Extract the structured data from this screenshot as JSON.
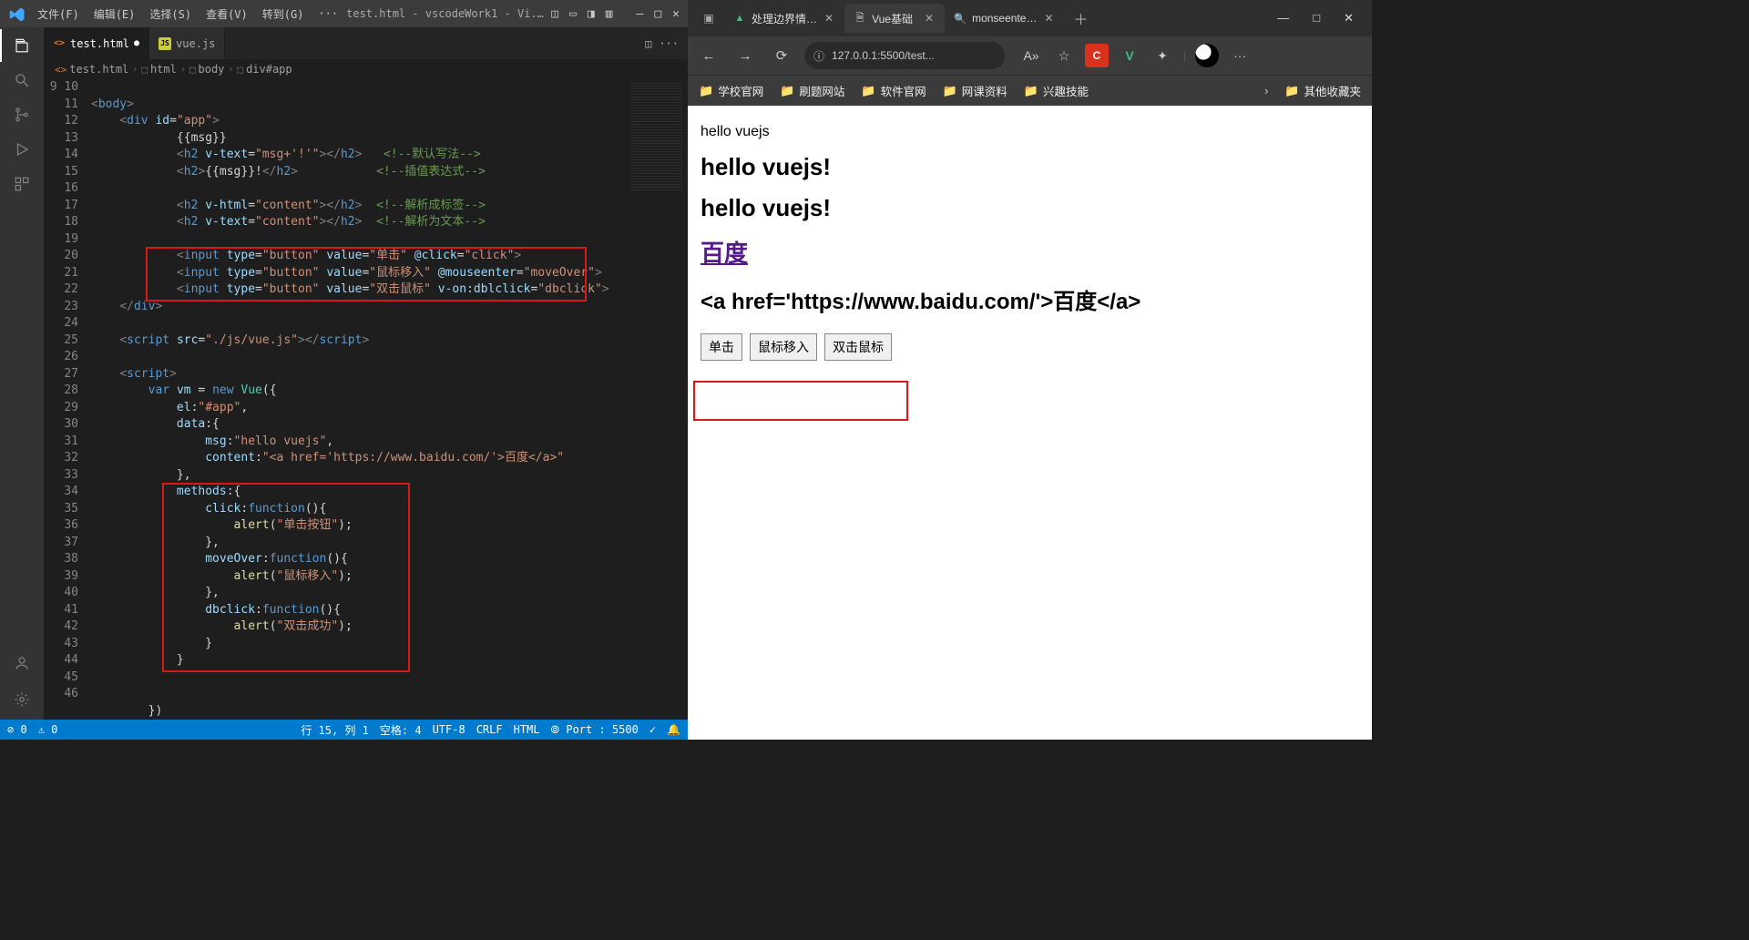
{
  "vscode": {
    "menu": [
      "文件(F)",
      "编辑(E)",
      "选择(S)",
      "查看(V)",
      "转到(G)"
    ],
    "title": "test.html - vscodeWork1 - Vi...",
    "tabs": [
      {
        "label": "test.html",
        "icon": "html",
        "active": true,
        "dirty": true
      },
      {
        "label": "vue.js",
        "icon": "js",
        "active": false,
        "dirty": false
      }
    ],
    "breadcrumbs": [
      "test.html",
      "html",
      "body",
      "div#app"
    ],
    "line_start": 9,
    "code_lines": [
      "",
      "<body>",
      "    <div id=\"app\">",
      "            {{msg}}",
      "            <h2 v-text=\"msg+'!'\"></h2>   <!--默认写法-->",
      "            <h2>{{msg}}!</h2>           <!--插值表达式-->",
      "",
      "            <h2 v-html=\"content\"></h2>  <!--解析成标签-->",
      "            <h2 v-text=\"content\"></h2>  <!--解析为文本-->",
      "",
      "            <input type=\"button\" value=\"单击\" @click=\"click\">",
      "            <input type=\"button\" value=\"鼠标移入\" @mouseenter=\"moveOver\">",
      "            <input type=\"button\" value=\"双击鼠标\" v-on:dblclick=\"dbclick\">",
      "    </div>",
      "",
      "    <script src=\"./js/vue.js\"></script>",
      "",
      "    <script>",
      "        var vm = new Vue({",
      "            el:\"#app\",",
      "            data:{",
      "                msg:\"hello vuejs\",",
      "                content:\"<a href='https://www.baidu.com/'>百度</a>\"",
      "            },",
      "            methods:{",
      "                click:function(){",
      "                    alert(\"单击按钮\");",
      "                },",
      "                moveOver:function(){",
      "                    alert(\"鼠标移入\");",
      "                },",
      "                dbclick:function(){",
      "                    alert(\"双击成功\");",
      "                }",
      "            }",
      "",
      "",
      "        })"
    ],
    "status": {
      "errors": "⊘ 0",
      "warnings": "⚠ 0",
      "cursor": "行 15, 列 1",
      "spaces": "空格: 4",
      "encoding": "UTF-8",
      "eol": "CRLF",
      "lang": "HTML",
      "port": "⦾ Port : 5500",
      "live": "✓",
      "bell": "🔔"
    }
  },
  "browser": {
    "tabs": [
      {
        "title": "处理边界情…",
        "icon": "vue",
        "active": false
      },
      {
        "title": "Vue基础",
        "icon": "doc",
        "active": true
      },
      {
        "title": "monseente…",
        "icon": "search",
        "active": false
      }
    ],
    "address": "127.0.0.1:5500/test...",
    "bookmarks": [
      "学校官网",
      "刷题网站",
      "软件官网",
      "网课资料",
      "兴趣技能"
    ],
    "bookmark_other": "其他收藏夹",
    "page": {
      "plain": "hello vuejs",
      "h2a": "hello vuejs!",
      "h2b": "hello vuejs!",
      "link_text": "百度",
      "raw_text": "<a href='https://www.baidu.com/'>百度</a>",
      "buttons": [
        "单击",
        "鼠标移入",
        "双击鼠标"
      ]
    }
  }
}
